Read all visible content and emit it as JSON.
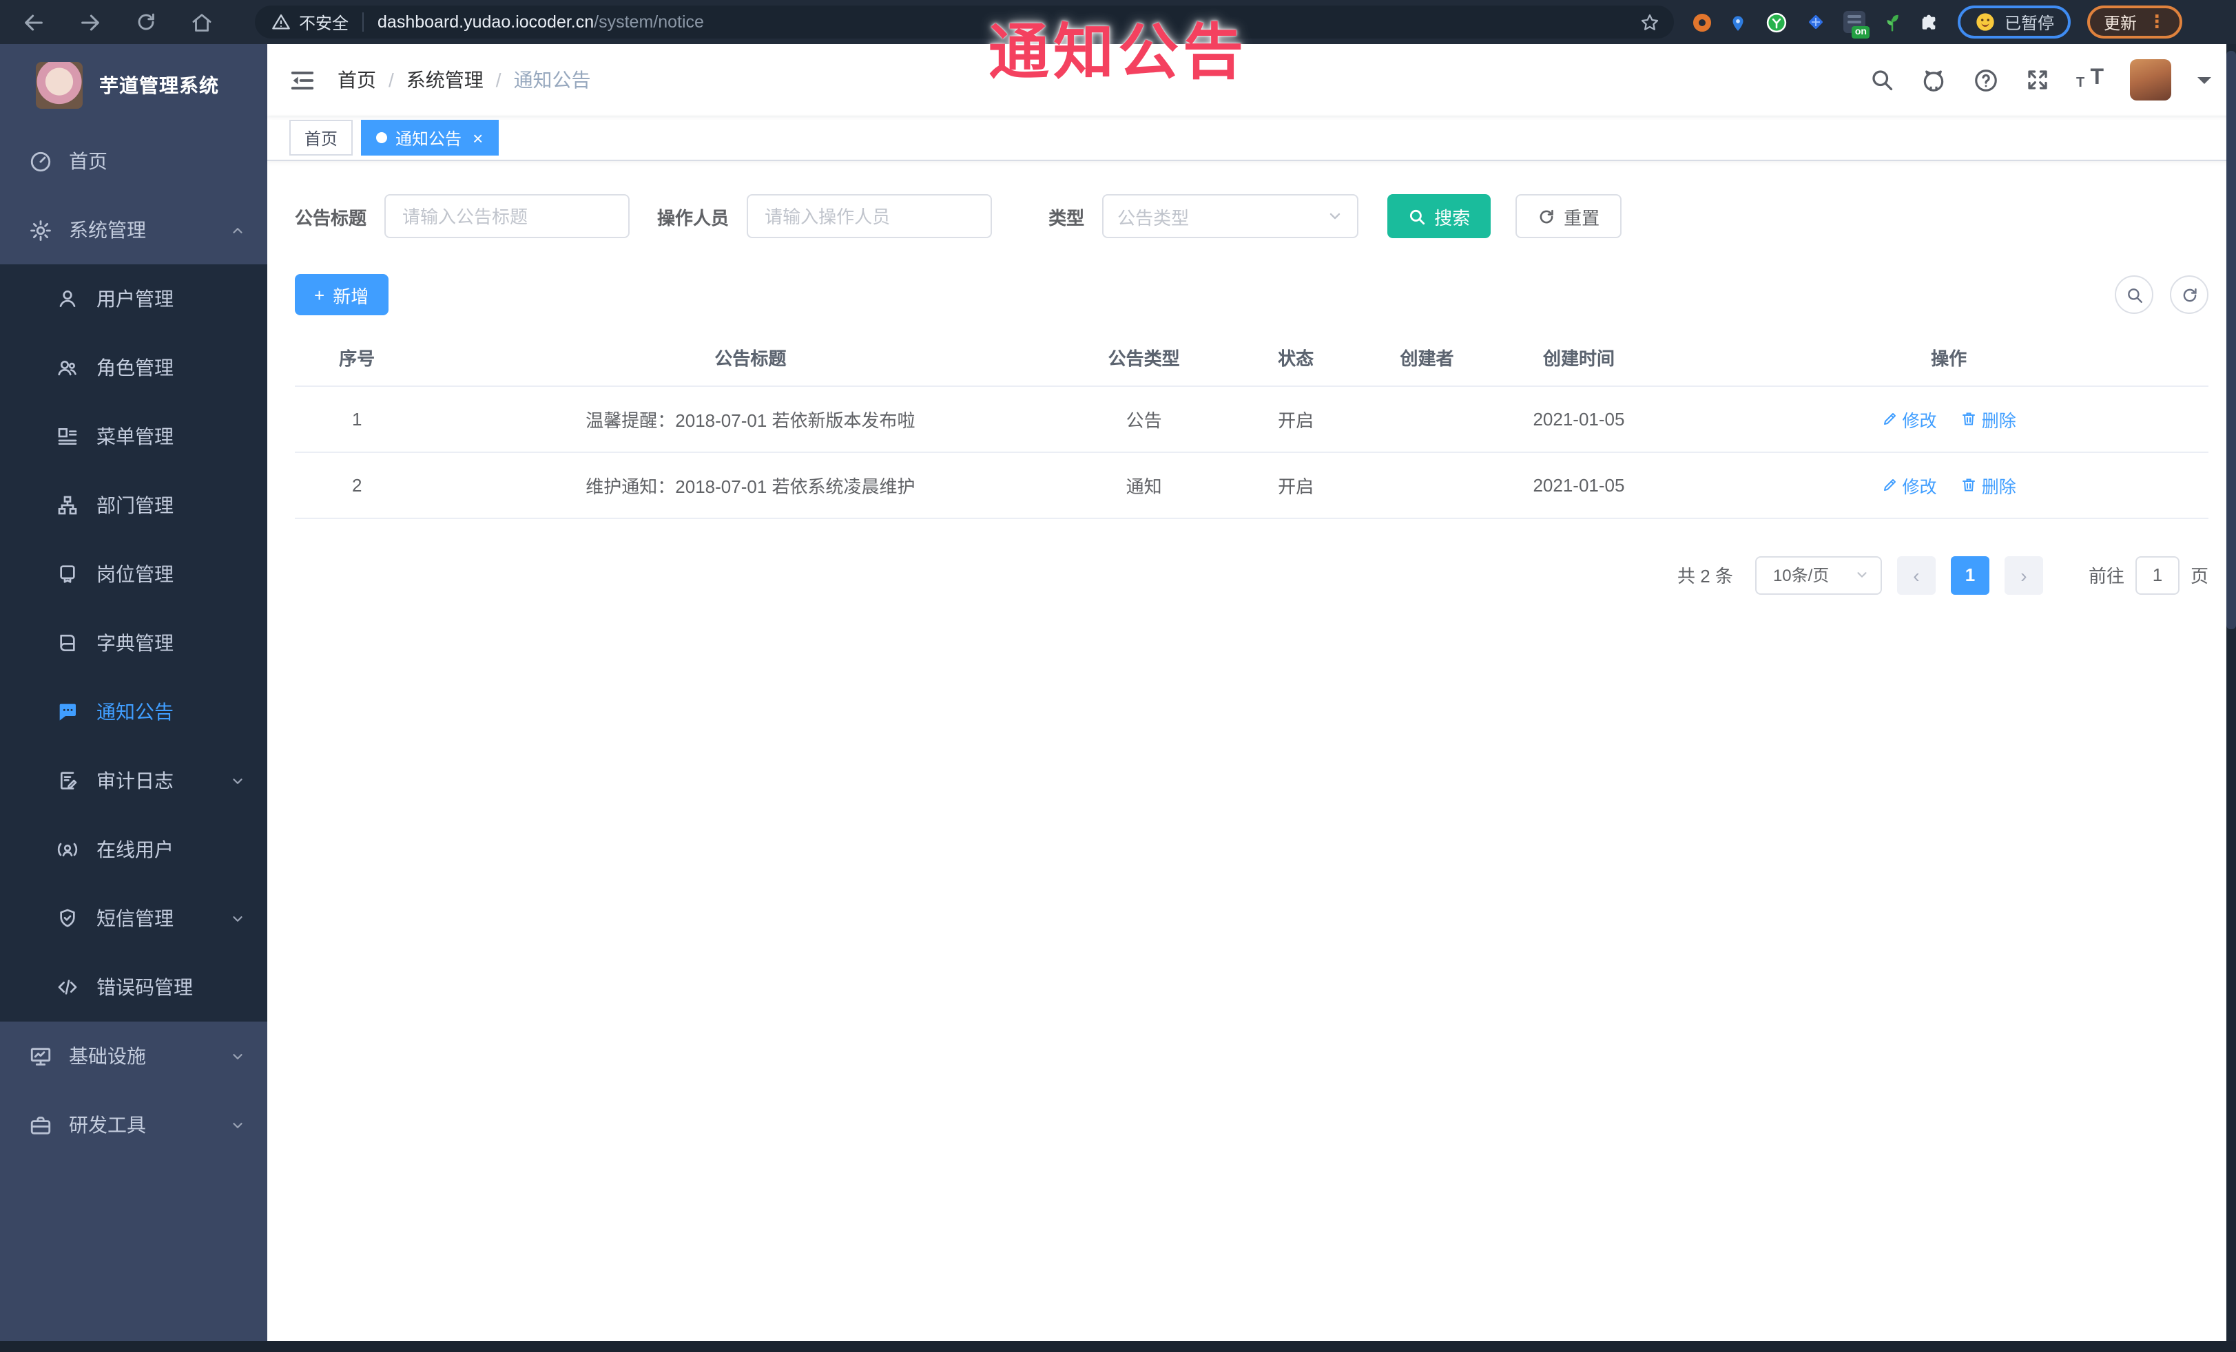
{
  "colors": {
    "accent": "#409eff",
    "teal": "#1abc9c",
    "overlay_pink": "#f4415f",
    "chrome_bg": "#212b39",
    "sidebar_bg": "#3a4763",
    "submenu_bg": "#1f2b3c"
  },
  "icons": {
    "breadcrumb_separator": "/",
    "tab_dot": "●",
    "tab_close": "×",
    "plus": "+",
    "pager_prev": "‹",
    "pager_next": "›",
    "menu_dots": "⋮"
  },
  "browser": {
    "security_label": "不安全",
    "url_host": "dashboard.yudao.iocoder.cn",
    "url_path": "/system/notice",
    "extension_badge": "on",
    "paused_label": "已暂停",
    "update_label": "更新"
  },
  "overlay_title": "通知公告",
  "sidebar": {
    "logo_title": "芋道管理系统",
    "items": [
      {
        "label": "首页",
        "icon": "dashboard-icon"
      },
      {
        "label": "系统管理",
        "icon": "gear-icon",
        "expanded": true
      },
      {
        "label": "用户管理",
        "icon": "user-icon"
      },
      {
        "label": "角色管理",
        "icon": "peoples-icon"
      },
      {
        "label": "菜单管理",
        "icon": "tree-table-icon"
      },
      {
        "label": "部门管理",
        "icon": "org-tree-icon"
      },
      {
        "label": "岗位管理",
        "icon": "post-icon"
      },
      {
        "label": "字典管理",
        "icon": "dict-book-icon"
      },
      {
        "label": "通知公告",
        "icon": "message-icon",
        "active": true
      },
      {
        "label": "审计日志",
        "icon": "audit-log-icon",
        "collapsible": true
      },
      {
        "label": "在线用户",
        "icon": "online-user-icon"
      },
      {
        "label": "短信管理",
        "icon": "sms-shield-icon",
        "collapsible": true
      },
      {
        "label": "错误码管理",
        "icon": "code-icon"
      },
      {
        "label": "基础设施",
        "icon": "monitor-icon",
        "collapsible": true
      },
      {
        "label": "研发工具",
        "icon": "toolbox-icon",
        "collapsible": true
      }
    ]
  },
  "navbar": {
    "breadcrumb": [
      "首页",
      "系统管理",
      "通知公告"
    ]
  },
  "tabs": [
    {
      "label": "首页",
      "active": false
    },
    {
      "label": "通知公告",
      "active": true,
      "closable": true
    }
  ],
  "filters": {
    "title_label": "公告标题",
    "title_placeholder": "请输入公告标题",
    "operator_label": "操作人员",
    "operator_placeholder": "请输入操作人员",
    "type_label": "类型",
    "type_placeholder": "公告类型",
    "search_label": "搜索",
    "reset_label": "重置"
  },
  "toolbar": {
    "add_label": "新增"
  },
  "table": {
    "columns": [
      "序号",
      "公告标题",
      "公告类型",
      "状态",
      "创建者",
      "创建时间",
      "操作"
    ],
    "edit_label": "修改",
    "delete_label": "删除",
    "rows": [
      {
        "no": "1",
        "title": "温馨提醒：2018-07-01 若依新版本发布啦",
        "type": "公告",
        "status": "开启",
        "creator": "",
        "created": "2021-01-05"
      },
      {
        "no": "2",
        "title": "维护通知：2018-07-01 若依系统凌晨维护",
        "type": "通知",
        "status": "开启",
        "creator": "",
        "created": "2021-01-05"
      }
    ]
  },
  "pagination": {
    "total_label": "共 2 条",
    "page_size_label": "10条/页",
    "current_page": "1",
    "goto_label": "前往",
    "goto_value": "1",
    "page_unit": "页"
  }
}
